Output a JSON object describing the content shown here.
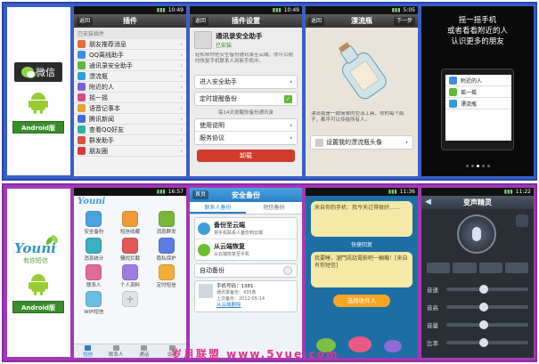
{
  "wechat": {
    "badge": {
      "logo_text": "微信",
      "android_label": "Android版"
    },
    "screen1": {
      "time": "10:49",
      "back": "返回",
      "title": "插件",
      "section": "已安装插件",
      "items": [
        "朋友推荐消息",
        "QQ离线助手",
        "通讯录安全助手",
        "漂流瓶",
        "附近的人",
        "摇一摇",
        "语音记事本",
        "腾讯新闻",
        "查看QQ好友",
        "群发助手",
        "朋友圈"
      ]
    },
    "screen2": {
      "time": "10:49",
      "back": "返回",
      "title": "插件设置",
      "plugin_name": "通讯录安全助手",
      "plugin_status": "已安装",
      "desc": "轻松帮你把安全备份通讯录至云端，你可以随时恢复手机联系人到新手机中。",
      "enter": "进入安全助手",
      "scheduled": "定时提醒备份",
      "scheduled_note": "每14天提醒你备份通讯录",
      "help": "使用说明",
      "agreement": "服务协议",
      "uninstall": "卸载"
    },
    "screen3": {
      "time": "5:05",
      "back": "返回",
      "title": "漂流瓶",
      "next": "下一步",
      "desc": "漂流瓶是一款简单的交流工具，你的每个瓶子，都不可以传给所有人。",
      "set_avatar": "设置我的漂流瓶头像"
    },
    "screen4": {
      "headline": "摇一摇手机\n或者看看附近的人\n认识更多的朋友",
      "menu": [
        "附近的人",
        "摇一摇",
        "漂流瓶"
      ]
    }
  },
  "youni": {
    "badge": {
      "logo_text": "Youni",
      "logo_sub": "有你短信",
      "android_label": "Android版"
    },
    "screen1": {
      "time": "16:57",
      "logo": "Youni",
      "tiles": [
        "安全备份",
        "短信收藏",
        "消息群发",
        "消息统计",
        "骚扰拦截",
        "隐私保护",
        "联系人",
        "个人资料",
        "定时短信",
        "WiFi短信",
        ""
      ],
      "tabs": [
        "短信",
        "联系人",
        "通话",
        "设置"
      ]
    },
    "screen2": {
      "back": "首页",
      "title": "安全备份",
      "tab_contacts": "联系人备份",
      "tab_sms": "短信备份",
      "backup_title": "备份至云端",
      "backup_sub": "将手机联系人备份到云端",
      "restore_title": "从云端恢复",
      "restore_sub": "从云端恢复至手机",
      "auto_backup": "自动备份",
      "phone_label": "手机号码：1381",
      "contacts_count": "通讯录备份：435条",
      "last_backup": "上次备份：2012-05-14",
      "delete_cloud": "从云端删除"
    },
    "screen3": {
      "time": "11:36",
      "bubble1": "来自你的手机：我今天过得很好……",
      "mid_label": "快捷回复",
      "bubble2": "我要睡，溜鬥訊話電影吧一輛機！[来自有你短信]",
      "select_btn": "选择收件人"
    },
    "screen4": {
      "time": "11:22",
      "title": "变声精灵",
      "labels": [
        "音速",
        "音高",
        "音量",
        "比率"
      ]
    }
  },
  "watermark": "岁月联盟 www.5yue.com"
}
